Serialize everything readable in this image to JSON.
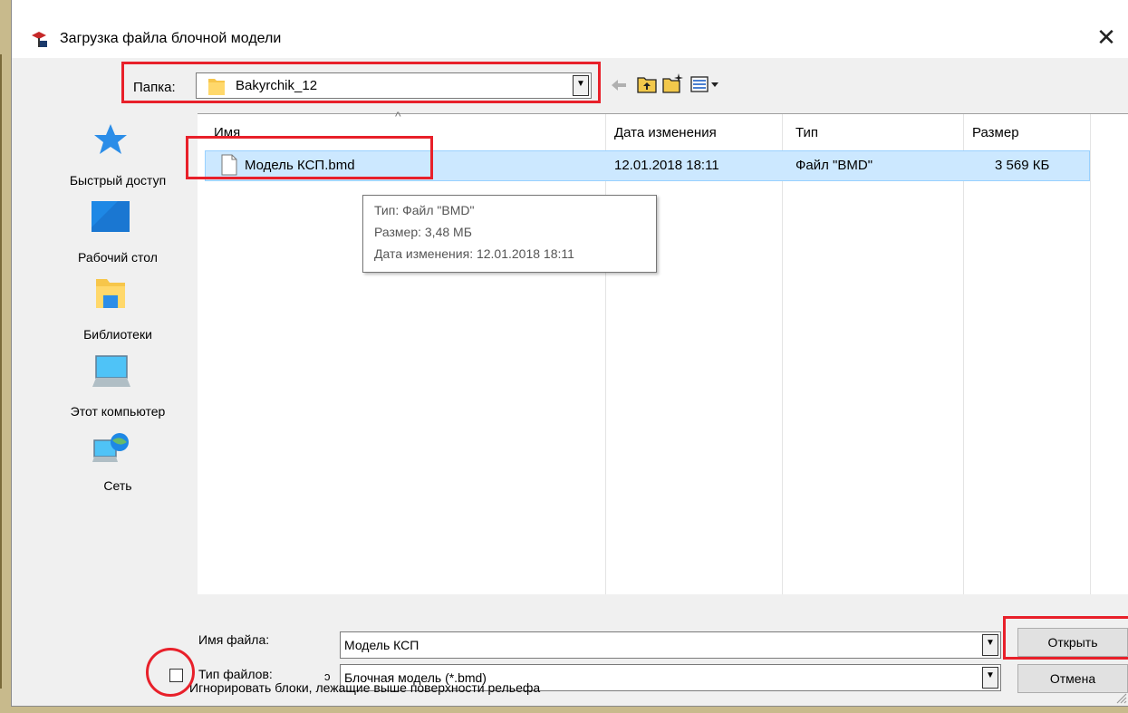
{
  "dialog": {
    "title": "Загрузка файла блочной модели",
    "close_glyph": "✕"
  },
  "toolbar": {
    "lookin_label": "Папка:",
    "folder_name": "Bakyrchik_12",
    "icons": [
      "back-arrow-icon",
      "up-folder-icon",
      "new-folder-icon",
      "view-menu-icon"
    ]
  },
  "places": [
    {
      "label": "Быстрый доступ",
      "icon": "star-icon"
    },
    {
      "label": "Рабочий стол",
      "icon": "desktop-icon"
    },
    {
      "label": "Библиотеки",
      "icon": "libraries-icon"
    },
    {
      "label": "Этот компьютер",
      "icon": "computer-icon"
    },
    {
      "label": "Сеть",
      "icon": "network-icon"
    }
  ],
  "columns": [
    "Имя",
    "Дата изменения",
    "Тип",
    "Размер"
  ],
  "files": [
    {
      "name": "Модель КСП.bmd",
      "date": "12.01.2018 18:11",
      "type": "Файл \"BMD\"",
      "size": "3 569 КБ"
    }
  ],
  "tooltip": {
    "line1": "Тип: Файл \"BMD\"",
    "line2": "Размер: 3,48 МБ",
    "line3": "Дата изменения: 12.01.2018 18:11"
  },
  "footer": {
    "filename_label": "Имя файла:",
    "filename_value": "Модель КСП",
    "filetype_label": "Тип файлов:",
    "filetype_prefix": "ɔ",
    "filetype_value": "Блочная модель (*.bmd)",
    "open_label": "Открыть",
    "cancel_label": "Отмена",
    "checkbox_label": "Игнорировать блоки, лежащие выше поверхности рельефа",
    "checkbox_checked": false
  },
  "colors": {
    "highlight": "#e8202a",
    "selection": "#cce8ff",
    "accent_blue": "#1e90ff"
  }
}
